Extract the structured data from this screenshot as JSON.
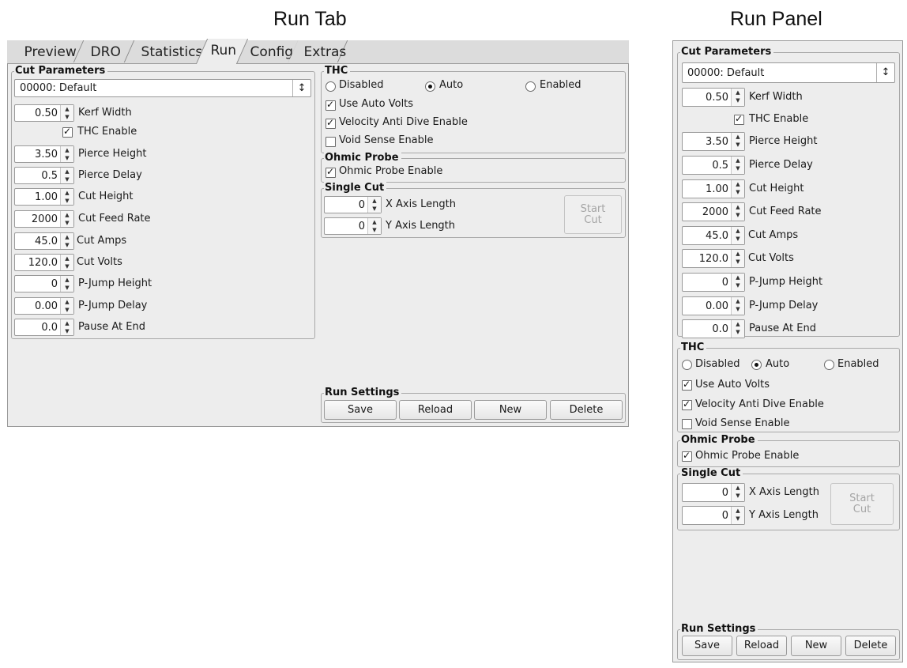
{
  "titles": {
    "run_tab": "Run Tab",
    "run_panel": "Run Panel"
  },
  "tabs": [
    "Preview",
    "DRO",
    "Statistics",
    "Run",
    "Config",
    "Extras"
  ],
  "active_tab": "Run",
  "cut_parameters": {
    "title": "Cut Parameters",
    "material": "00000: Default",
    "kerf_width": {
      "value": "0.50",
      "label": "Kerf Width"
    },
    "thc_enable": {
      "label": "THC Enable",
      "checked": true
    },
    "pierce_height": {
      "value": "3.50",
      "label": "Pierce Height"
    },
    "pierce_delay": {
      "value": "0.5",
      "label": "Pierce Delay"
    },
    "cut_height": {
      "value": "1.00",
      "label": "Cut Height"
    },
    "cut_feed_rate": {
      "value": "2000",
      "label": "Cut Feed Rate"
    },
    "cut_amps": {
      "value": "45.0",
      "label": "Cut Amps"
    },
    "cut_volts": {
      "value": "120.0",
      "label": "Cut Volts"
    },
    "pjump_height": {
      "value": "0",
      "label": "P-Jump Height"
    },
    "pjump_delay": {
      "value": "0.00",
      "label": "P-Jump Delay"
    },
    "pause_at_end": {
      "value": "0.0",
      "label": "Pause At End"
    }
  },
  "thc": {
    "title": "THC",
    "mode_disabled": "Disabled",
    "mode_auto": "Auto",
    "mode_enabled": "Enabled",
    "selected_mode": "Auto",
    "use_auto_volts": "Use Auto Volts",
    "velocity_anti_dive": "Velocity Anti Dive Enable",
    "void_sense": "Void Sense Enable"
  },
  "ohmic_probe": {
    "title": "Ohmic Probe",
    "enable": "Ohmic Probe Enable"
  },
  "single_cut": {
    "title": "Single Cut",
    "x_value": "0",
    "x_label": "X Axis Length",
    "y_value": "0",
    "y_label": "Y Axis Length",
    "start_label": "Start\nCut"
  },
  "run_settings": {
    "title": "Run Settings",
    "save": "Save",
    "reload": "Reload",
    "new": "New",
    "delete": "Delete"
  },
  "icons": {
    "spin": "spinbox-arrows-icon",
    "combo": "combo-updown-icon"
  },
  "colors": {
    "panel_bg": "#ededed",
    "border": "#9a9a9a",
    "disabled_text": "#a5a5a5"
  }
}
